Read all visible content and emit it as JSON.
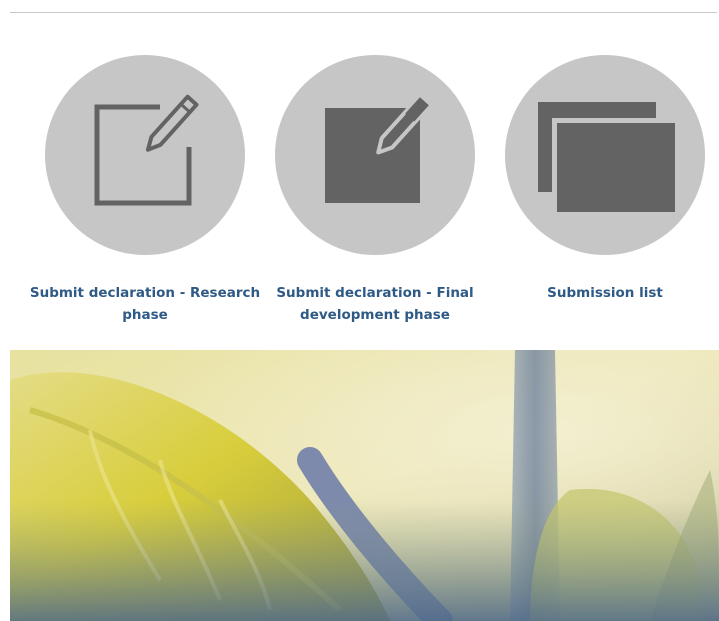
{
  "tiles": [
    {
      "label": "Submit declaration - Research phase",
      "icon": "edit-outline-icon"
    },
    {
      "label": "Submit declaration - Final development phase",
      "icon": "edit-filled-icon"
    },
    {
      "label": "Submission list",
      "icon": "stacked-documents-icon"
    }
  ],
  "colors": {
    "circle": "#c6c6c6",
    "icon": "#636363",
    "link": "#2f5a86",
    "rule": "#c9c9c9"
  },
  "banner": {
    "image": "yellow-green leaf nature photo"
  }
}
